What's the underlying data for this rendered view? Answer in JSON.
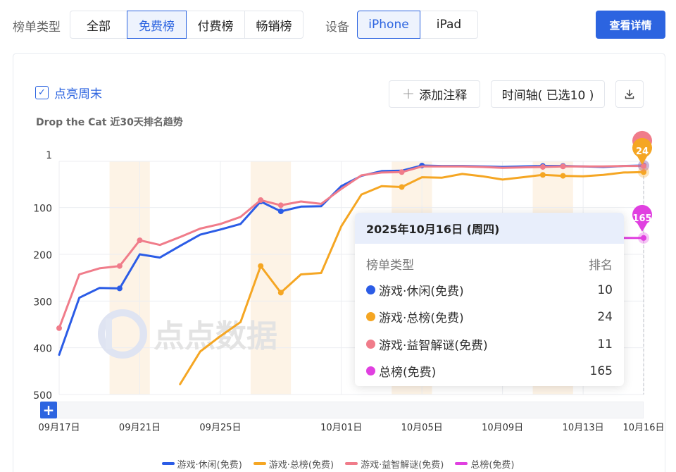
{
  "filters": {
    "type_label": "榜单类型",
    "type_options": [
      "全部",
      "免费榜",
      "付费榜",
      "畅销榜"
    ],
    "type_selected": 1,
    "device_label": "设备",
    "device_options": [
      "iPhone",
      "iPad"
    ],
    "device_selected": 0,
    "details_button": "查看详情"
  },
  "toolbar": {
    "highlight_weekend": "点亮周末",
    "add_note": "添加注释",
    "timeline": "时间轴( 已选10 )"
  },
  "watermark": "点点数据",
  "tooltip": {
    "date": "2025年10月16日 (周四)",
    "col_type": "榜单类型",
    "col_rank": "排名",
    "rows": [
      {
        "name": "游戏·休闲(免费)",
        "rank": "10"
      },
      {
        "name": "游戏·总榜(免费)",
        "rank": "24"
      },
      {
        "name": "游戏·益智解谜(免费)",
        "rank": "11"
      },
      {
        "name": "总榜(免费)",
        "rank": "165"
      }
    ]
  },
  "chart_data": {
    "type": "line",
    "title": "Drop the Cat 近30天排名趋势",
    "y_ticks": [
      1,
      100,
      200,
      300,
      400,
      500
    ],
    "ylim": [
      1,
      500
    ],
    "y_reversed": true,
    "x": [
      "2025-09-17",
      "2025-09-18",
      "2025-09-19",
      "2025-09-20",
      "2025-09-21",
      "2025-09-22",
      "2025-09-23",
      "2025-09-24",
      "2025-09-25",
      "2025-09-26",
      "2025-09-27",
      "2025-09-28",
      "2025-09-29",
      "2025-09-30",
      "2025-10-01",
      "2025-10-02",
      "2025-10-03",
      "2025-10-04",
      "2025-10-05",
      "2025-10-06",
      "2025-10-07",
      "2025-10-08",
      "2025-10-09",
      "2025-10-10",
      "2025-10-11",
      "2025-10-12",
      "2025-10-13",
      "2025-10-14",
      "2025-10-15",
      "2025-10-16"
    ],
    "x_tick_labels": [
      "09月17日",
      "09月21日",
      "09月25日",
      "10月01日",
      "10月05日",
      "10月09日",
      "10月13日",
      "10月16日"
    ],
    "x_tick_dates": [
      "2025-09-17",
      "2025-09-21",
      "2025-09-25",
      "2025-10-01",
      "2025-10-05",
      "2025-10-09",
      "2025-10-13",
      "2025-10-16"
    ],
    "weekend_bands": [
      [
        "2025-09-20",
        "2025-09-21"
      ],
      [
        "2025-09-27",
        "2025-09-28"
      ],
      [
        "2025-10-04",
        "2025-10-05"
      ],
      [
        "2025-10-11",
        "2025-10-12"
      ]
    ],
    "grid": true,
    "legend_position": "bottom",
    "series": [
      {
        "name": "游戏·休闲(免费)",
        "color": "#2b5ce6",
        "values": [
          415,
          293,
          272,
          273,
          200,
          207,
          182,
          158,
          147,
          135,
          87,
          108,
          98,
          97,
          54,
          32,
          22,
          21,
          10,
          11,
          11,
          12,
          13,
          12,
          11,
          11,
          12,
          13,
          11,
          10
        ],
        "markers": [
          3,
          10,
          11,
          18,
          24,
          25,
          29
        ]
      },
      {
        "name": "游戏·总榜(免费)",
        "color": "#f5a623",
        "values": [
          null,
          null,
          null,
          null,
          null,
          null,
          478,
          408,
          375,
          345,
          225,
          282,
          243,
          240,
          140,
          72,
          54,
          56,
          35,
          36,
          28,
          33,
          40,
          35,
          30,
          32,
          33,
          30,
          25,
          24
        ],
        "markers": [
          10,
          11,
          17,
          24,
          25,
          29
        ]
      },
      {
        "name": "游戏·益智解谜(免费)",
        "color": "#f07c8a",
        "values": [
          358,
          243,
          230,
          225,
          170,
          180,
          163,
          145,
          135,
          120,
          84,
          95,
          87,
          92,
          60,
          31,
          25,
          24,
          12,
          12,
          12,
          13,
          15,
          14,
          13,
          12,
          12,
          12,
          11,
          11
        ],
        "markers": [
          0,
          3,
          4,
          10,
          11,
          17,
          24,
          25,
          29
        ]
      },
      {
        "name": "总榜(免费)",
        "color": "#e040e0",
        "values": [
          null,
          null,
          null,
          null,
          null,
          null,
          null,
          null,
          null,
          null,
          null,
          null,
          null,
          null,
          null,
          null,
          null,
          null,
          null,
          null,
          null,
          null,
          null,
          null,
          null,
          null,
          null,
          null,
          165,
          165
        ],
        "markers": [
          29
        ]
      }
    ],
    "end_labels": [
      "10",
      "24",
      "165"
    ]
  }
}
